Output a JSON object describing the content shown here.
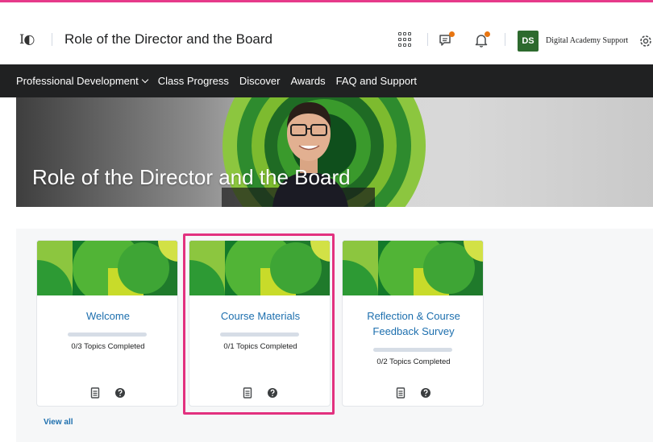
{
  "header": {
    "logo_text": "I◐",
    "course_title": "Role of the Director and the Board",
    "user_initials": "DS",
    "user_name": "Digital Academy Support",
    "icons": [
      "waffle-icon",
      "chat-icon",
      "bell-icon",
      "gear-icon"
    ],
    "notification_dot_color": "#e87511"
  },
  "nav": {
    "items": [
      {
        "label": "Professional Development",
        "has_dropdown": true
      },
      {
        "label": "Class Progress"
      },
      {
        "label": "Discover"
      },
      {
        "label": "Awards"
      },
      {
        "label": "FAQ and Support"
      }
    ]
  },
  "banner": {
    "title": "Role of the Director and the Board"
  },
  "cards": [
    {
      "title": "Welcome",
      "completed": 0,
      "total": 3,
      "progress_text": "0/3  Topics Completed"
    },
    {
      "title": "Course Materials",
      "completed": 0,
      "total": 1,
      "progress_text": "0/1  Topics Completed"
    },
    {
      "title": "Reflection & Course Feedback Survey",
      "completed": 0,
      "total": 2,
      "progress_text": "0/2  Topics Completed"
    }
  ],
  "view_all": "View all",
  "colors": {
    "accent_link": "#1d6fae",
    "nav_bg": "#202122",
    "highlight": "#e2317f",
    "avatar_bg": "#2d6a2e"
  }
}
